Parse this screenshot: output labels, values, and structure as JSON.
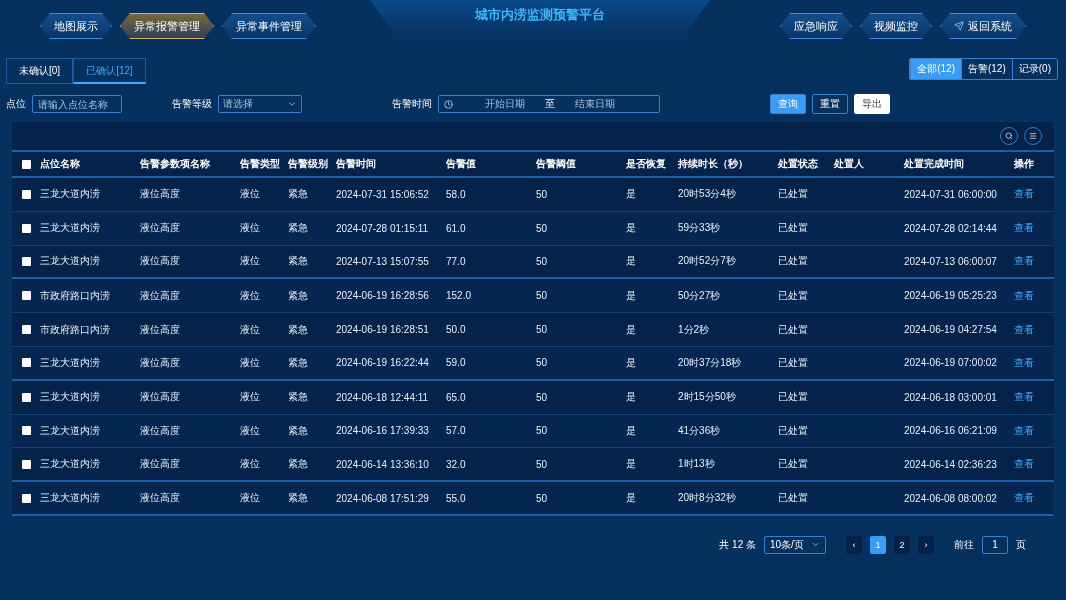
{
  "title": "城市内涝监测预警平台",
  "nav_left": [
    {
      "label": "地图展示",
      "selected": false
    },
    {
      "label": "异常报警管理",
      "selected": true
    },
    {
      "label": "异常事件管理",
      "selected": false
    }
  ],
  "nav_right": [
    {
      "label": "应急响应",
      "kind": "plain"
    },
    {
      "label": "视频监控",
      "kind": "plain"
    },
    {
      "label": "返回系统",
      "kind": "return"
    }
  ],
  "tabs": [
    {
      "label": "未确认[0]",
      "selected": false
    },
    {
      "label": "已确认[12]",
      "selected": true
    }
  ],
  "segments": [
    {
      "label": "全部(12)",
      "selected": true
    },
    {
      "label": "告警(12)",
      "selected": false
    },
    {
      "label": "记录(0)",
      "selected": false
    }
  ],
  "filters": {
    "point_label": "点位",
    "point_placeholder": "请输入点位名称",
    "level_label": "告警等级",
    "level_placeholder": "请选择",
    "time_label": "告警时间",
    "start_placeholder": "开始日期",
    "separator": "至",
    "end_placeholder": "结束日期"
  },
  "actions": [
    {
      "label": "查询",
      "kind": "primary"
    },
    {
      "label": "重置",
      "kind": "outline"
    },
    {
      "label": "导出",
      "kind": "light"
    }
  ],
  "table": {
    "all_checked": false,
    "columns": [
      "点位名称",
      "告警参数项名称",
      "告警类型",
      "告警级别",
      "告警时间",
      "告警值",
      "告警阈值",
      "是否恢复",
      "持续时长（秒）",
      "处置状态",
      "处置人",
      "处置完成时间",
      "操作"
    ],
    "rows": [
      {
        "checked": false,
        "cells": [
          "三龙大道内涝",
          "液位高度",
          "液位",
          "紧急",
          "2024-07-31 15:06:52",
          "58.0",
          "50",
          "是",
          "20时53分4秒",
          "已处置",
          "",
          "2024-07-31 06:00:00"
        ],
        "action": "查看"
      },
      {
        "checked": false,
        "cells": [
          "三龙大道内涝",
          "液位高度",
          "液位",
          "紧急",
          "2024-07-28 01:15:11",
          "61.0",
          "50",
          "是",
          "59分33秒",
          "已处置",
          "",
          "2024-07-28 02:14:44"
        ],
        "action": "查看"
      },
      {
        "checked": false,
        "cells": [
          "三龙大道内涝",
          "液位高度",
          "液位",
          "紧急",
          "2024-07-13 15:07:55",
          "77.0",
          "50",
          "是",
          "20时52分7秒",
          "已处置",
          "",
          "2024-07-13 06:00:07"
        ],
        "action": "查看"
      },
      {
        "checked": false,
        "cells": [
          "市政府路口内涝",
          "液位高度",
          "液位",
          "紧急",
          "2024-06-19 16:28:56",
          "152.0",
          "50",
          "是",
          "50分27秒",
          "已处置",
          "",
          "2024-06-19 05:25:23"
        ],
        "action": "查看"
      },
      {
        "checked": false,
        "cells": [
          "市政府路口内涝",
          "液位高度",
          "液位",
          "紧急",
          "2024-06-19 16:28:51",
          "50.0",
          "50",
          "是",
          "1分2秒",
          "已处置",
          "",
          "2024-06-19 04:27:54"
        ],
        "action": "查看"
      },
      {
        "checked": false,
        "cells": [
          "三龙大道内涝",
          "液位高度",
          "液位",
          "紧急",
          "2024-06-19 16:22:44",
          "59.0",
          "50",
          "是",
          "20时37分18秒",
          "已处置",
          "",
          "2024-06-19 07:00:02"
        ],
        "action": "查看"
      },
      {
        "checked": false,
        "cells": [
          "三龙大道内涝",
          "液位高度",
          "液位",
          "紧急",
          "2024-06-18 12:44:11",
          "65.0",
          "50",
          "是",
          "2时15分50秒",
          "已处置",
          "",
          "2024-06-18 03:00:01"
        ],
        "action": "查看"
      },
      {
        "checked": false,
        "cells": [
          "三龙大道内涝",
          "液位高度",
          "液位",
          "紧急",
          "2024-06-16 17:39:33",
          "57.0",
          "50",
          "是",
          "41分36秒",
          "已处置",
          "",
          "2024-06-16 06:21:09"
        ],
        "action": "查看"
      },
      {
        "checked": false,
        "cells": [
          "三龙大道内涝",
          "液位高度",
          "液位",
          "紧急",
          "2024-06-14 13:36:10",
          "32.0",
          "50",
          "是",
          "1时13秒",
          "已处置",
          "",
          "2024-06-14 02:36:23"
        ],
        "action": "查看"
      },
      {
        "checked": false,
        "cells": [
          "三龙大道内涝",
          "液位高度",
          "液位",
          "紧急",
          "2024-06-08 17:51:29",
          "55.0",
          "50",
          "是",
          "20时8分32秒",
          "已处置",
          "",
          "2024-06-08 08:00:02"
        ],
        "action": "查看"
      }
    ]
  },
  "pagination": {
    "total": "共 12 条",
    "page_size": "10条/页",
    "prev": "‹",
    "next": "›",
    "pages": [
      {
        "label": "1",
        "selected": true
      },
      {
        "label": "2",
        "selected": false
      }
    ],
    "goto_label": "前往",
    "goto_value": "1",
    "goto_suffix": "页"
  }
}
